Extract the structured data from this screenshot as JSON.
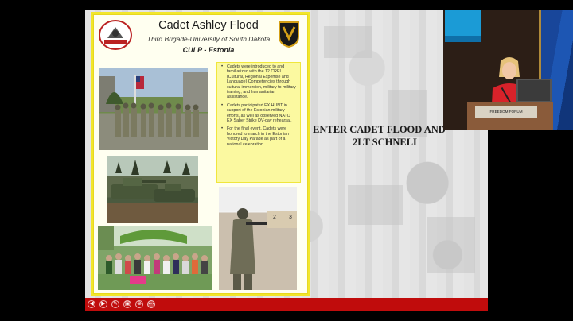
{
  "slide": {
    "title_line1": "ENTER CADET FLOOD AND",
    "title_line2": "2LT SCHNELL"
  },
  "poster": {
    "name": "Cadet Ashley Flood",
    "subtitle": "Third Brigade-University of South Dakota",
    "location": "CULP - Estonia",
    "left_logo_text": "UNIVERSITY OF SOUTH DAKOTA",
    "bullets": [
      "Cadets were introduced to and familiarized with the 12 CREL (Cultural, Regional Expertise and Language) Competencies through cultural immersion, military to military training, and humanitarian assistance.",
      "Cadets participated EX HUNT in support of the Estonian military efforts, as well as observed NATO EX Saber Strike DV-day rehearsal.",
      "For the final event, Cadets were honored to march in the Estonian Victory Day Parade as part of a national celebration."
    ],
    "range_numbers": [
      "2",
      "3"
    ]
  },
  "controls": {
    "icons": [
      "previous-icon",
      "next-icon",
      "pen-icon",
      "slides-icon",
      "zoom-icon",
      "more-icon"
    ],
    "glyphs": [
      "◀",
      "▶",
      "✎",
      "▣",
      "⊕",
      "⋯"
    ]
  },
  "camera": {
    "podium_label": "FREEDOM FORUM"
  },
  "colors": {
    "control_bar": "#c00c0c",
    "poster_border": "#f2e62a",
    "textbox_bg": "#fbf9a0"
  }
}
